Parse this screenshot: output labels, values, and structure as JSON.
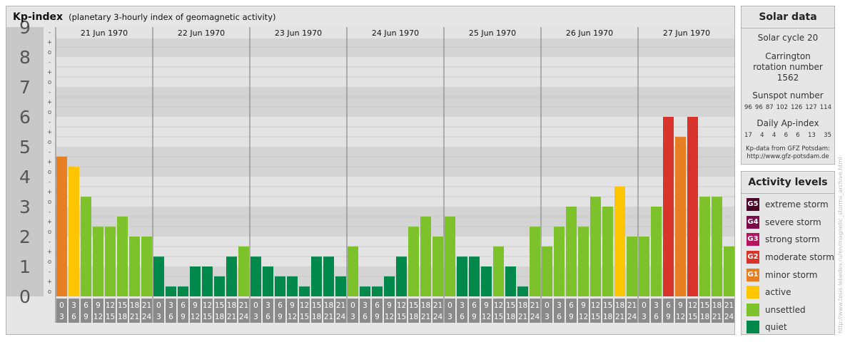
{
  "title": "Kp-index",
  "subtitle": "(planetary 3-hourly index of geomagnetic activity)",
  "chart_data": {
    "type": "bar",
    "title": "Kp-index",
    "subtitle": "(planetary 3-hourly index of geomagnetic activity)",
    "ylim": [
      0,
      9
    ],
    "yticks": [
      "0",
      "1",
      "2",
      "3",
      "4",
      "5",
      "6",
      "7",
      "8",
      "9"
    ],
    "minor_ticks": [
      "o",
      "+",
      "-"
    ],
    "days": [
      "21 Jun 1970",
      "22 Jun 1970",
      "23 Jun 1970",
      "24 Jun 1970",
      "25 Jun 1970",
      "26 Jun 1970",
      "27 Jun 1970"
    ],
    "interval_starts": [
      "0",
      "3",
      "6",
      "9",
      "12",
      "15",
      "18",
      "21"
    ],
    "interval_ends": [
      "3",
      "6",
      "9",
      "12",
      "15",
      "18",
      "21",
      "24"
    ],
    "values": [
      4.67,
      4.33,
      3.33,
      2.33,
      2.33,
      2.67,
      2.0,
      2.0,
      1.33,
      0.33,
      0.33,
      1.0,
      1.0,
      0.67,
      1.33,
      1.67,
      1.33,
      1.0,
      0.67,
      0.67,
      0.33,
      1.33,
      1.33,
      0.67,
      1.67,
      0.33,
      0.33,
      0.67,
      1.33,
      2.33,
      2.67,
      2.0,
      2.67,
      1.33,
      1.33,
      1.0,
      1.67,
      1.0,
      0.33,
      2.33,
      1.67,
      2.33,
      3.0,
      2.33,
      3.33,
      3.0,
      3.67,
      2.0,
      2.0,
      3.0,
      6.0,
      5.33,
      6.0,
      3.33,
      3.33,
      1.67
    ],
    "grid": true,
    "legend": "right"
  },
  "colors": {
    "quiet": "#00894a",
    "unsettled": "#7ec22b",
    "active": "#ffc600",
    "G1": "#e67e22",
    "G2": "#d9342b",
    "G3": "#b3165f",
    "G4": "#7a0c4b",
    "G5": "#4a0027",
    "band_light": "#e3e3e3",
    "band_dark": "#d4d4d4",
    "ylabel_bg": "#c8c8c8",
    "xlabel_bg": "#8a8a8a"
  },
  "solar": {
    "title": "Solar data",
    "cycle": "Solar cycle 20",
    "carrington": "Carrington rotation number 1562",
    "sunspot_title": "Sunspot number",
    "sunspot_values": [
      "96",
      "96",
      "87",
      "102",
      "126",
      "127",
      "114"
    ],
    "ap_title": "Daily Ap-index",
    "ap_values": [
      "17",
      "4",
      "4",
      "6",
      "6",
      "13",
      "35"
    ],
    "source_line1": "Kp-data from GFZ Potsdam:",
    "source_line2": "http://www.gfz-potsdam.de"
  },
  "activity": {
    "title": "Activity levels",
    "levels": [
      {
        "code": "G5",
        "label": "extreme storm",
        "color": "#4a0027"
      },
      {
        "code": "G4",
        "label": "severe storm",
        "color": "#7a0c4b"
      },
      {
        "code": "G3",
        "label": "strong storm",
        "color": "#b3165f"
      },
      {
        "code": "G2",
        "label": "moderate storm",
        "color": "#d9342b"
      },
      {
        "code": "G1",
        "label": "minor storm",
        "color": "#e67e22"
      },
      {
        "code": "",
        "label": "active",
        "color": "#ffc600"
      },
      {
        "code": "",
        "label": "unsettled",
        "color": "#7ec22b"
      },
      {
        "code": "",
        "label": "quiet",
        "color": "#00894a"
      }
    ]
  },
  "credit": "http://www.tesis.lebedev.ru/en/magnetic_storms_archive.html"
}
